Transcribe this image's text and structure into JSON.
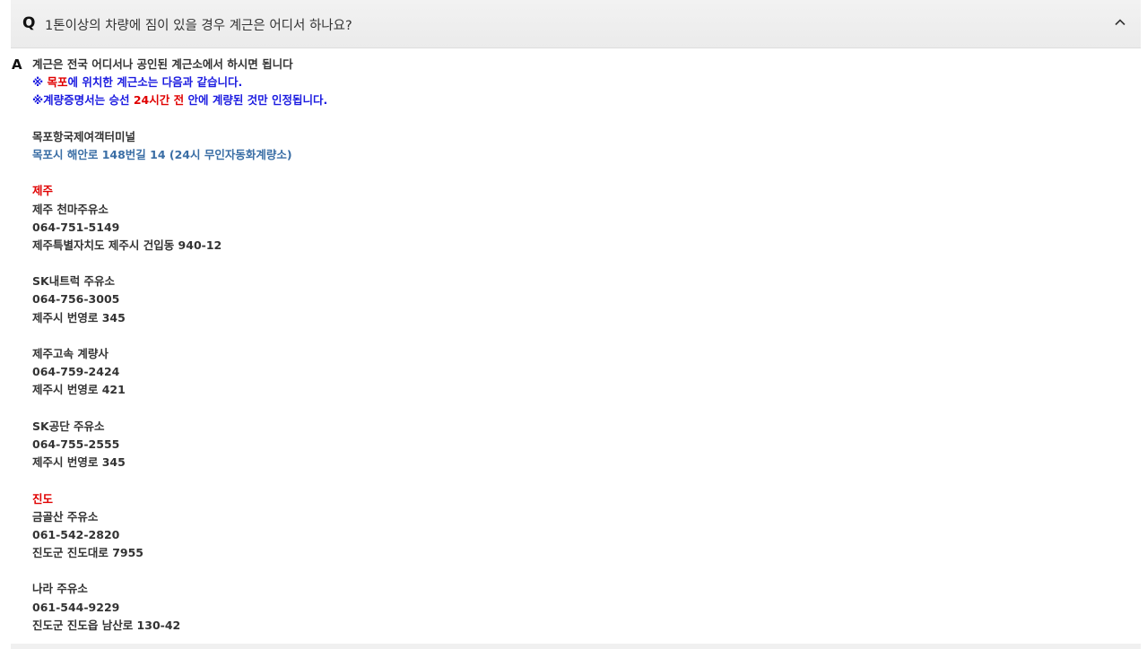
{
  "question": {
    "mark": "Q",
    "text": "1톤이상의 차량에 짐이 있을 경우 계근은 어디서 하나요?",
    "toggle_icon": "chevron-up-icon"
  },
  "answer": {
    "mark": "A",
    "intro": "계근은 전국 어디서나 공인된 계근소에서 하시면 됩니다",
    "note1": {
      "prefix": "※ ",
      "highlight": "목포",
      "suffix": "에 위치한 계근소는 다음과 같습니다."
    },
    "note2": {
      "prefix": "※계량증명서는 승선 ",
      "highlight": "24시간 전",
      "suffix": " 안에 계량된 것만 인정됩니다."
    },
    "mokpo": {
      "name": "목포항국제여객터미널",
      "address": "목포시 해안로 148번길 14 (24시 무인자동화계량소)"
    },
    "regions": [
      {
        "region": "제주",
        "stations": [
          {
            "name": "제주 천마주유소",
            "phone": "064-751-5149",
            "address": "제주특별자치도 제주시 건입동 940-12"
          },
          {
            "name": "SK내트럭 주유소",
            "phone": "064-756-3005",
            "address": "제주시 번영로 345"
          },
          {
            "name": "제주고속 계량사",
            "phone": "064-759-2424",
            "address": "제주시 번영로 421"
          },
          {
            "name": "SK공단 주유소",
            "phone": "064-755-2555",
            "address": "제주시 번영로 345"
          }
        ]
      },
      {
        "region": "진도",
        "stations": [
          {
            "name": "금골산 주유소",
            "phone": "061-542-2820",
            "address": "진도군 진도대로 7955"
          },
          {
            "name": "나라 주유소",
            "phone": "061-544-9229",
            "address": "진도군 진도읍 남산로 130-42"
          }
        ]
      }
    ]
  }
}
